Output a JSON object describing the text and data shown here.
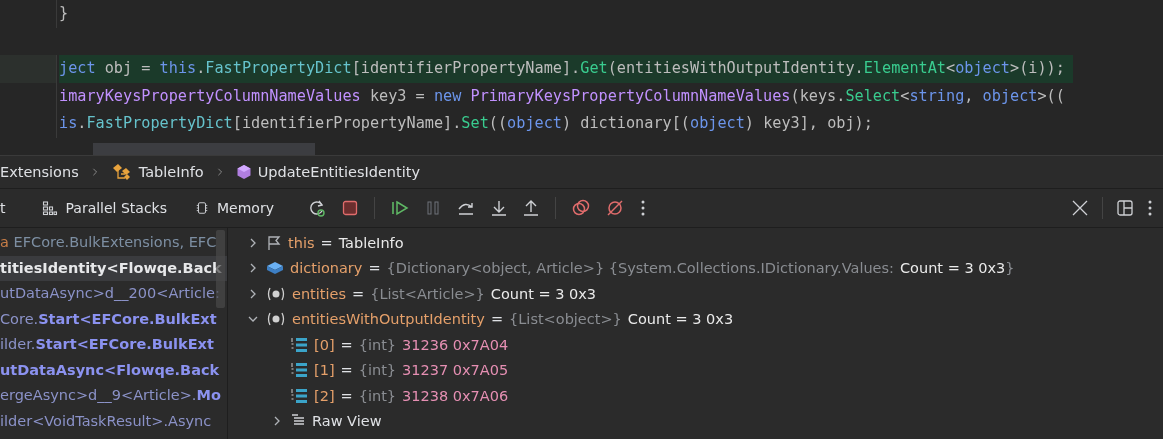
{
  "editor": {
    "lines": [
      {
        "highlighted": false,
        "tokens": [
          {
            "t": "}",
            "kind": "plain"
          }
        ]
      },
      {
        "highlighted": true,
        "gap_before": true,
        "tokens": [
          {
            "t": "ject",
            "kind": "kw"
          },
          {
            "t": " obj = ",
            "kind": "plain"
          },
          {
            "t": "this",
            "kind": "kw"
          },
          {
            "t": ".",
            "kind": "plain"
          },
          {
            "t": "FastPropertyDict",
            "kind": "field"
          },
          {
            "t": "[identifierPropertyName].",
            "kind": "plain"
          },
          {
            "t": "Get",
            "kind": "method"
          },
          {
            "t": "(entitiesWithOutputIdentity.",
            "kind": "plain"
          },
          {
            "t": "ElementAt",
            "kind": "method"
          },
          {
            "t": "<",
            "kind": "plain"
          },
          {
            "t": "object",
            "kind": "kw"
          },
          {
            "t": ">(i));",
            "kind": "plain"
          }
        ]
      },
      {
        "highlighted": false,
        "tokens": [
          {
            "t": "imaryKeysPropertyColumnNameValues",
            "kind": "type"
          },
          {
            "t": " key3 = ",
            "kind": "plain"
          },
          {
            "t": "new ",
            "kind": "kw"
          },
          {
            "t": "PrimaryKeysPropertyColumnNameValues",
            "kind": "type"
          },
          {
            "t": "(keys.",
            "kind": "plain"
          },
          {
            "t": "Select",
            "kind": "method"
          },
          {
            "t": "<",
            "kind": "plain"
          },
          {
            "t": "string",
            "kind": "kw"
          },
          {
            "t": ", ",
            "kind": "plain"
          },
          {
            "t": "object",
            "kind": "kw"
          },
          {
            "t": ">((",
            "kind": "plain"
          }
        ]
      },
      {
        "highlighted": false,
        "tokens": [
          {
            "t": "is",
            "kind": "kw"
          },
          {
            "t": ".",
            "kind": "plain"
          },
          {
            "t": "FastPropertyDict",
            "kind": "field"
          },
          {
            "t": "[identifierPropertyName].",
            "kind": "plain"
          },
          {
            "t": "Set",
            "kind": "method"
          },
          {
            "t": "((",
            "kind": "plain"
          },
          {
            "t": "object",
            "kind": "kw"
          },
          {
            "t": ") dictionary[(",
            "kind": "plain"
          },
          {
            "t": "object",
            "kind": "kw"
          },
          {
            "t": ") key3], obj);",
            "kind": "plain"
          }
        ]
      }
    ]
  },
  "breadcrumb": [
    {
      "label": "Extensions",
      "kind": "namespace"
    },
    {
      "label": "TableInfo",
      "kind": "class"
    },
    {
      "label": "UpdateEntitiesIdentity",
      "kind": "method"
    }
  ],
  "debug_toolbar": {
    "tabs": [
      {
        "label": "t",
        "kind": "plain"
      },
      {
        "label": "Parallel Stacks",
        "kind": "stacks"
      },
      {
        "label": "Memory",
        "kind": "memory"
      }
    ]
  },
  "frames": [
    {
      "selected": false,
      "parts": [
        {
          "text": "a",
          "kind": "lib"
        },
        {
          "text": " EFCore.BulkExtensions, EFC",
          "kind": "external"
        }
      ]
    },
    {
      "selected": true,
      "parts": [
        {
          "text": "titiesIdentity<Flowqe.Back",
          "kind": "current"
        }
      ]
    },
    {
      "selected": false,
      "parts": [
        {
          "text": "utDataAsync>d__200<Article:",
          "kind": "code"
        }
      ]
    },
    {
      "selected": false,
      "parts": [
        {
          "text": "Core.",
          "kind": "code"
        },
        {
          "text": "Start<EFCore.BulkExt",
          "kind": "method"
        }
      ]
    },
    {
      "selected": false,
      "parts": [
        {
          "text": "ilder.",
          "kind": "code"
        },
        {
          "text": "Start<EFCore.BulkExt",
          "kind": "method"
        }
      ]
    },
    {
      "selected": false,
      "parts": [
        {
          "text": "utDataAsync<Flowqe.Back",
          "kind": "method"
        }
      ]
    },
    {
      "selected": false,
      "parts": [
        {
          "text": "ergeAsync>d__9<Article>.",
          "kind": "code"
        },
        {
          "text": "Mo",
          "kind": "method"
        }
      ]
    },
    {
      "selected": false,
      "parts": [
        {
          "text": "ilder<VoidTaskResult>.Async",
          "kind": "code"
        }
      ]
    }
  ],
  "variables": [
    {
      "kind": "this",
      "name": "this",
      "expanded": false,
      "operator": "=",
      "value": "TableInfo"
    },
    {
      "kind": "field",
      "name": "dictionary",
      "expanded": false,
      "operator": "=",
      "type": "{Dictionary<object, Article>} {System.Collections.IDictionary.Values:",
      "value": "Count = 3 0x3",
      "suffix": "}"
    },
    {
      "kind": "local",
      "name": "entities",
      "expanded": false,
      "operator": "=",
      "type": "{List<Article>}",
      "value": "Count = 3 0x3"
    },
    {
      "kind": "local",
      "name": "entitiesWithOutputIdentity",
      "expanded": true,
      "operator": "=",
      "type": "{List<object>}",
      "value": "Count = 3 0x3",
      "children": [
        {
          "kind": "int",
          "name": "[0]",
          "operator": "=",
          "type": "{int}",
          "value": "31236 0x7A04"
        },
        {
          "kind": "int",
          "name": "[1]",
          "operator": "=",
          "type": "{int}",
          "value": "31237 0x7A05"
        },
        {
          "kind": "int",
          "name": "[2]",
          "operator": "=",
          "type": "{int}",
          "value": "31238 0x7A06"
        },
        {
          "kind": "raw",
          "name": "Raw View",
          "expanded": false
        }
      ]
    }
  ]
}
